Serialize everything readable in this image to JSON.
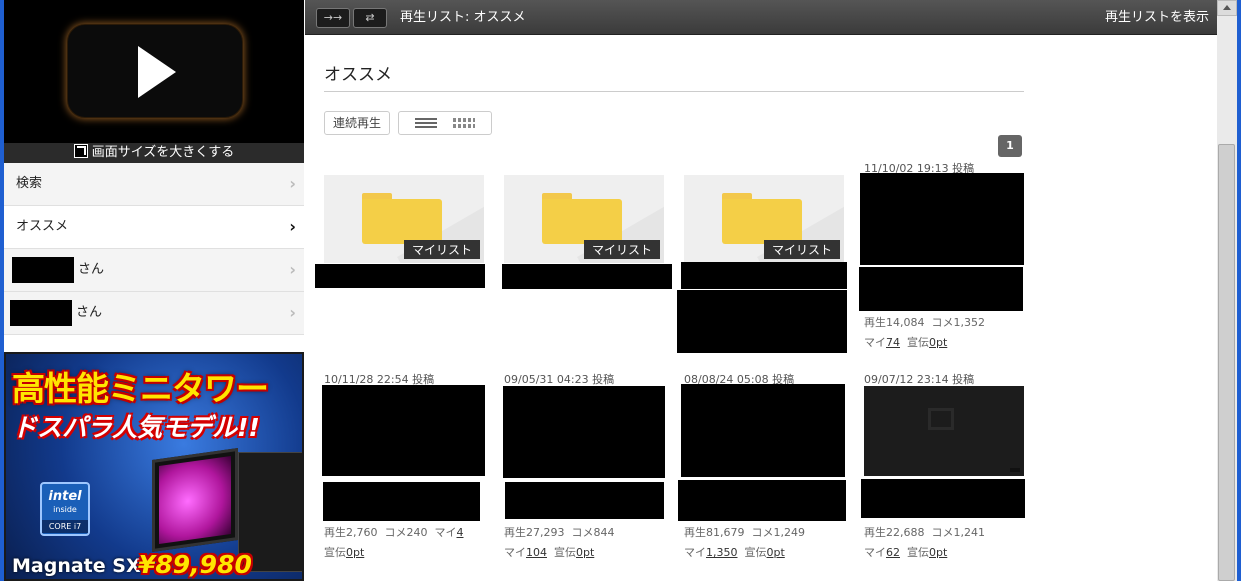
{
  "player": {
    "enlarge_label": "画面サイズを大きくする"
  },
  "nav": {
    "items": [
      {
        "label": "検索"
      },
      {
        "label": "オススメ"
      },
      {
        "label": "さん"
      },
      {
        "label": "さん"
      }
    ]
  },
  "ad": {
    "line1": "高性能ミニタワー",
    "line2": "ドスパラ人気モデル!!",
    "intel_logo": "intel",
    "intel_inside": "inside",
    "intel_core": "CORE i7",
    "model": "Magnate SX",
    "price": "¥89,980"
  },
  "topbar": {
    "title": "再生リスト: オススメ",
    "show_label": "再生リストを表示"
  },
  "main": {
    "heading": "オススメ",
    "continuous_label": "連続再生",
    "page": "1",
    "mylist_tag": "マイリスト",
    "items": [
      {
        "date": "11/10/02 19:13 投稿",
        "views": "再生14,084",
        "comments": "コメ1,352",
        "my_label": "マイ",
        "mylist": "74",
        "ad_label": "宣伝",
        "ad": "0pt"
      },
      {
        "date": "10/11/28 22:54 投稿",
        "views": "再生2,760",
        "comments": "コメ240",
        "my_label": "マイ",
        "mylist": "4",
        "ad_label": "宣伝",
        "ad": "0pt"
      },
      {
        "date": "09/05/31 04:23 投稿",
        "views": "再生27,293",
        "comments": "コメ844",
        "my_label": "マイ",
        "mylist": "104",
        "ad_label": "宣伝",
        "ad": "0pt"
      },
      {
        "date": "08/08/24 05:08 投稿",
        "views": "再生81,679",
        "comments": "コメ1,249",
        "my_label": "マイ",
        "mylist": "1,350",
        "ad_label": "宣伝",
        "ad": "0pt"
      },
      {
        "date": "09/07/12 23:14 投稿",
        "views": "再生22,688",
        "comments": "コメ1,241",
        "my_label": "マイ",
        "mylist": "62",
        "ad_label": "宣伝",
        "ad": "0pt"
      }
    ]
  }
}
